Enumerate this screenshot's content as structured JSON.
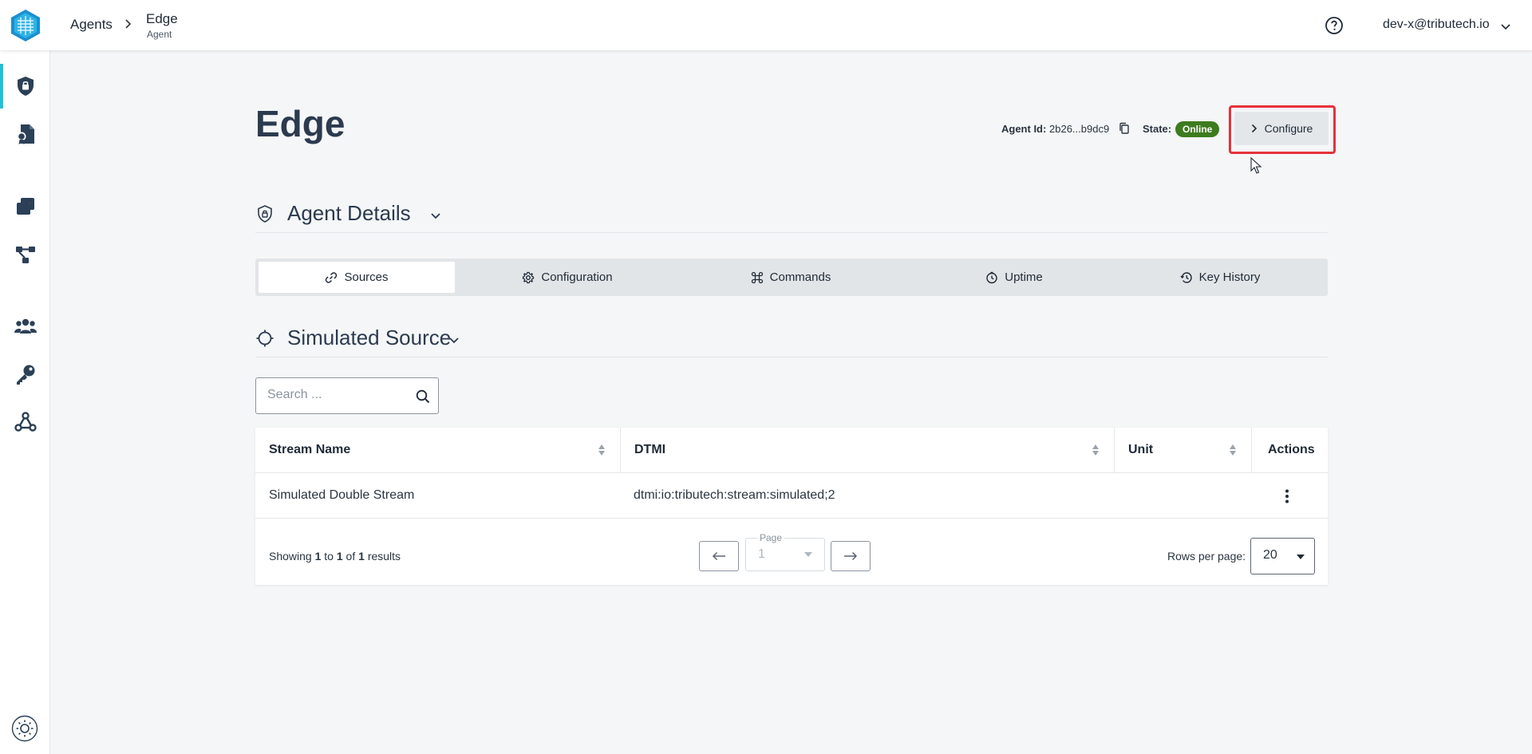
{
  "header": {
    "breadcrumb_root": "Agents",
    "breadcrumb_current": "Edge",
    "breadcrumb_sub": "Agent",
    "user_email": "dev-x@tributech.io"
  },
  "sidebar": {
    "items": [
      {
        "icon": "shield-lock-icon",
        "active": true
      },
      {
        "icon": "file-cert-icon",
        "active": false
      },
      {
        "icon": "cards-icon",
        "active": false
      },
      {
        "icon": "network-icon",
        "active": false
      },
      {
        "icon": "users-icon",
        "active": false
      },
      {
        "icon": "key-icon",
        "active": false
      },
      {
        "icon": "webhook-icon",
        "active": false
      }
    ],
    "theme_icon": "sun-icon"
  },
  "page": {
    "title": "Edge",
    "agent_id_label": "Agent Id:",
    "agent_id_value": "2b26...b9dc9",
    "state_label": "State:",
    "state_value": "Online",
    "configure_label": "Configure"
  },
  "agent_details": {
    "title": "Agent Details"
  },
  "tabs": [
    {
      "label": "Sources",
      "icon": "link-icon",
      "active": true
    },
    {
      "label": "Configuration",
      "icon": "gear-icon",
      "active": false
    },
    {
      "label": "Commands",
      "icon": "command-icon",
      "active": false
    },
    {
      "label": "Uptime",
      "icon": "clock-icon",
      "active": false
    },
    {
      "label": "Key History",
      "icon": "history-icon",
      "active": false
    }
  ],
  "source": {
    "title": "Simulated Source",
    "search_placeholder": "Search ..."
  },
  "table": {
    "columns": [
      "Stream Name",
      "DTMI",
      "Unit",
      "Actions"
    ],
    "rows": [
      {
        "stream_name": "Simulated Double Stream",
        "dtmi": "dtmi:io:tributech:stream:simulated;2",
        "unit": ""
      }
    ],
    "footer": {
      "showing_prefix": "Showing",
      "from": "1",
      "to_word": "to",
      "to": "1",
      "of_word": "of",
      "total": "1",
      "results_word": "results",
      "page_label": "Page",
      "page_value": "1",
      "rows_per_page_label": "Rows per page:",
      "rows_per_page_value": "20"
    }
  },
  "colors": {
    "accent": "#22c0d8",
    "online": "#3d7c1e",
    "highlight": "#e5323a",
    "icon": "#2b4057"
  }
}
